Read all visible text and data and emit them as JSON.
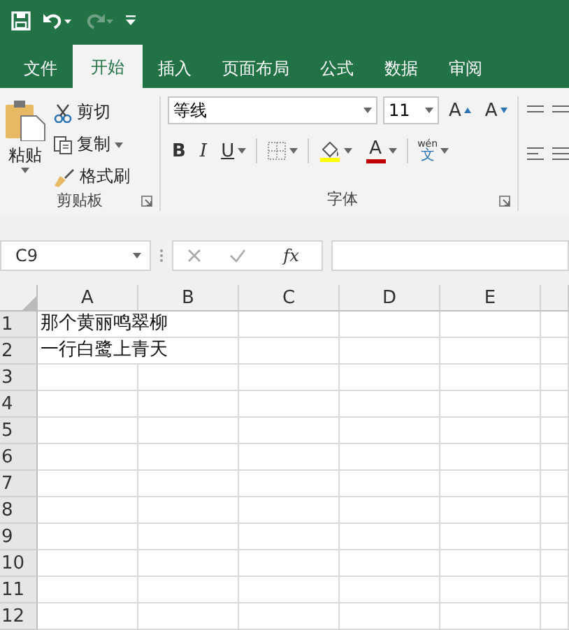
{
  "quick_access": [
    {
      "kind": "save",
      "disabled": false
    },
    {
      "kind": "undo",
      "disabled": false
    },
    {
      "kind": "redo",
      "disabled": true
    },
    {
      "kind": "customize",
      "disabled": false
    }
  ],
  "tabs": [
    {
      "label": "文件",
      "selected": false
    },
    {
      "label": "开始",
      "selected": true
    },
    {
      "label": "插入",
      "selected": false
    },
    {
      "label": "页面布局",
      "selected": false
    },
    {
      "label": "公式",
      "selected": false
    },
    {
      "label": "数据",
      "selected": false
    },
    {
      "label": "审阅",
      "selected": false
    }
  ],
  "clipboard": {
    "paste": "粘贴",
    "cut": "剪切",
    "copy": "复制",
    "format_painter": "格式刷",
    "label": "剪贴板"
  },
  "font": {
    "font_name": "等线",
    "font_size": "11",
    "grow": "A",
    "shrink": "A",
    "bold": "B",
    "italic": "I",
    "underline": "U",
    "font_color": "A",
    "phonetic_top": "wén",
    "phonetic": "文",
    "label": "字体"
  },
  "formula_bar": {
    "name_box": "C9",
    "fx": "fx"
  },
  "sheet": {
    "columns": [
      "A",
      "B",
      "C",
      "D",
      "E",
      ""
    ],
    "rows": [
      {
        "number": "1",
        "cells": [
          "那个黄丽鸣翠柳"
        ]
      },
      {
        "number": "2",
        "cells": [
          "一行白鹭上青天"
        ]
      },
      {
        "number": "3",
        "cells": []
      },
      {
        "number": "4",
        "cells": []
      },
      {
        "number": "5",
        "cells": []
      },
      {
        "number": "6",
        "cells": []
      },
      {
        "number": "7",
        "cells": []
      },
      {
        "number": "8",
        "cells": []
      },
      {
        "number": "9",
        "cells": []
      },
      {
        "number": "10",
        "cells": []
      },
      {
        "number": "11",
        "cells": []
      },
      {
        "number": "12",
        "cells": []
      }
    ]
  }
}
